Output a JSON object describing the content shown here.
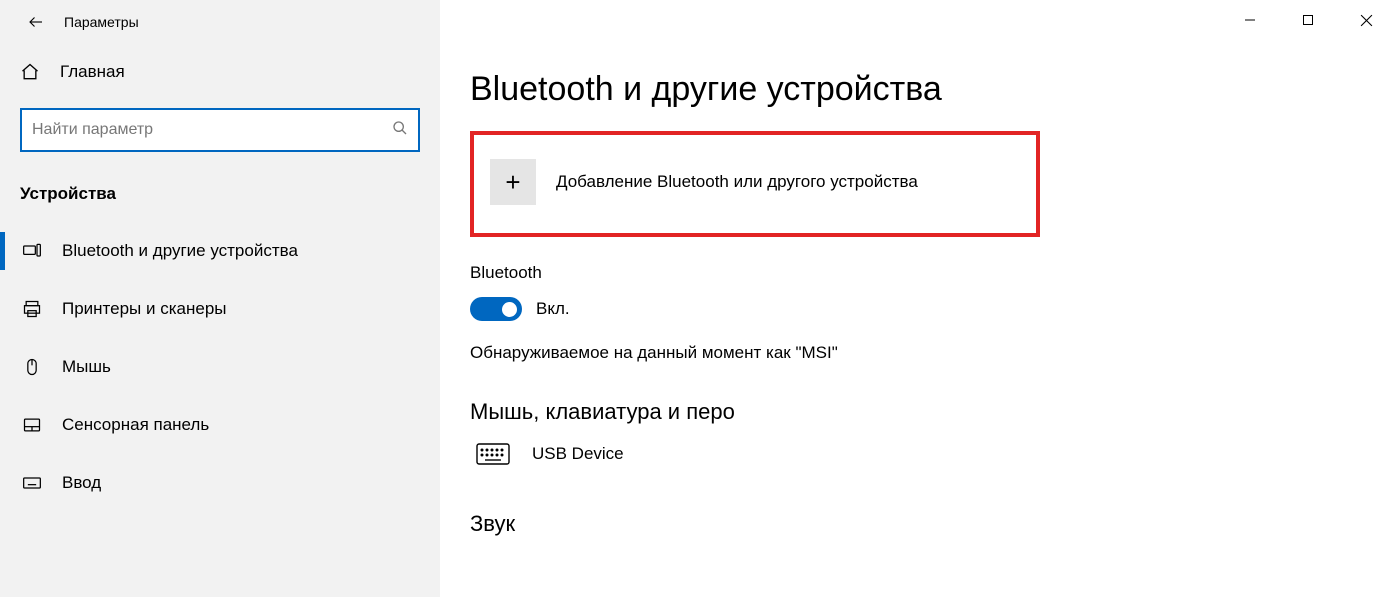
{
  "appTitle": "Параметры",
  "home": "Главная",
  "searchPlaceholder": "Найти параметр",
  "category": "Устройства",
  "nav": [
    {
      "label": "Bluetooth и другие устройства"
    },
    {
      "label": "Принтеры и сканеры"
    },
    {
      "label": "Мышь"
    },
    {
      "label": "Сенсорная панель"
    },
    {
      "label": "Ввод"
    }
  ],
  "page": {
    "title": "Bluetooth и другие устройства",
    "addDevice": "Добавление Bluetooth или другого устройства",
    "bluetoothHeading": "Bluetooth",
    "toggleState": "Вкл.",
    "discoverable": "Обнаруживаемое на данный момент как \"MSI\"",
    "inputSection": "Мышь, клавиатура и перо",
    "device1": "USB Device",
    "soundSection": "Звук"
  }
}
